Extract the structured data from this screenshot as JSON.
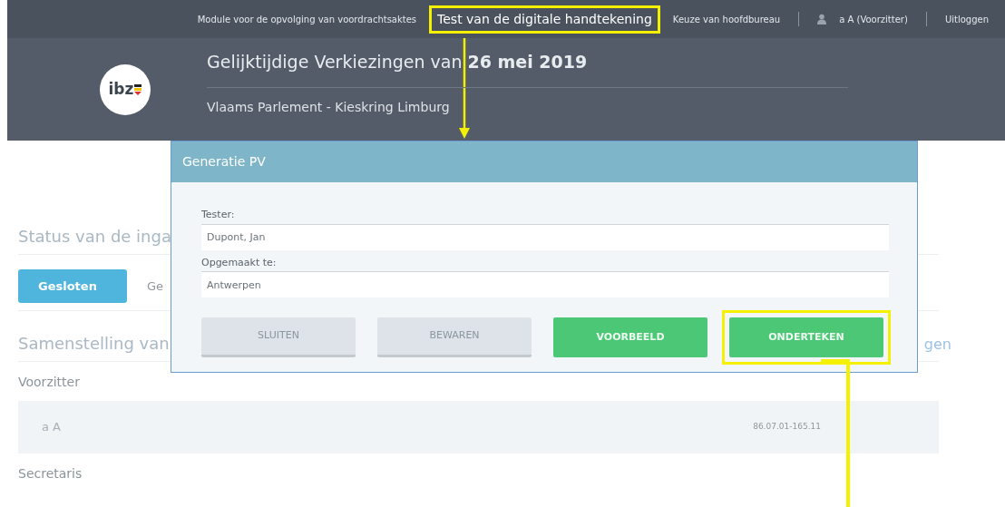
{
  "top_bar": {
    "links": [
      {
        "kind": "link",
        "text": "Module voor de opvolging van voordrachtsaktes",
        "highlighted": false
      },
      {
        "kind": "link",
        "text": "Test van de digitale handtekening",
        "highlighted": true
      },
      {
        "kind": "link",
        "text": "Keuze van hoofdbureau",
        "highlighted": false
      },
      {
        "kind": "user",
        "text": "a A (Voorzitter)",
        "highlighted": false
      },
      {
        "kind": "link",
        "text": "Uitloggen",
        "highlighted": false
      }
    ]
  },
  "header": {
    "logo": "ibz",
    "title": "Gelijktijdige Verkiezingen van **26 mei 2019**",
    "subtitle": "Vlaams Parlement - Kieskring Limburg"
  },
  "content": {
    "status_heading": "Status van de inga",
    "status_tabs": [
      {
        "label": "Gesloten",
        "selected": true
      },
      {
        "label": "Ge",
        "selected": false
      }
    ],
    "composition_heading": "Samenstelling van",
    "composition_link": "gen",
    "roles": [
      {
        "title": "Voorzitter",
        "members": [
          {
            "name": "a A",
            "number": "86.07.01-165.11"
          }
        ]
      },
      {
        "title": "Secretaris"
      }
    ]
  },
  "modal": {
    "title": "Generatie PV",
    "fields": [
      {
        "label": "Tester:",
        "value": "Dupont, Jan"
      },
      {
        "label": "Opgemaakt te:",
        "value": "Antwerpen"
      }
    ],
    "buttons": [
      {
        "label": "SLUITEN",
        "kind": "secondary",
        "highlighted": false
      },
      {
        "label": "BEWAREN",
        "kind": "secondary",
        "highlighted": false
      },
      {
        "label": "VOORBEELD",
        "kind": "primary",
        "highlighted": false
      },
      {
        "label": "ONDERTEKEN",
        "kind": "primary",
        "highlighted": true
      }
    ]
  }
}
